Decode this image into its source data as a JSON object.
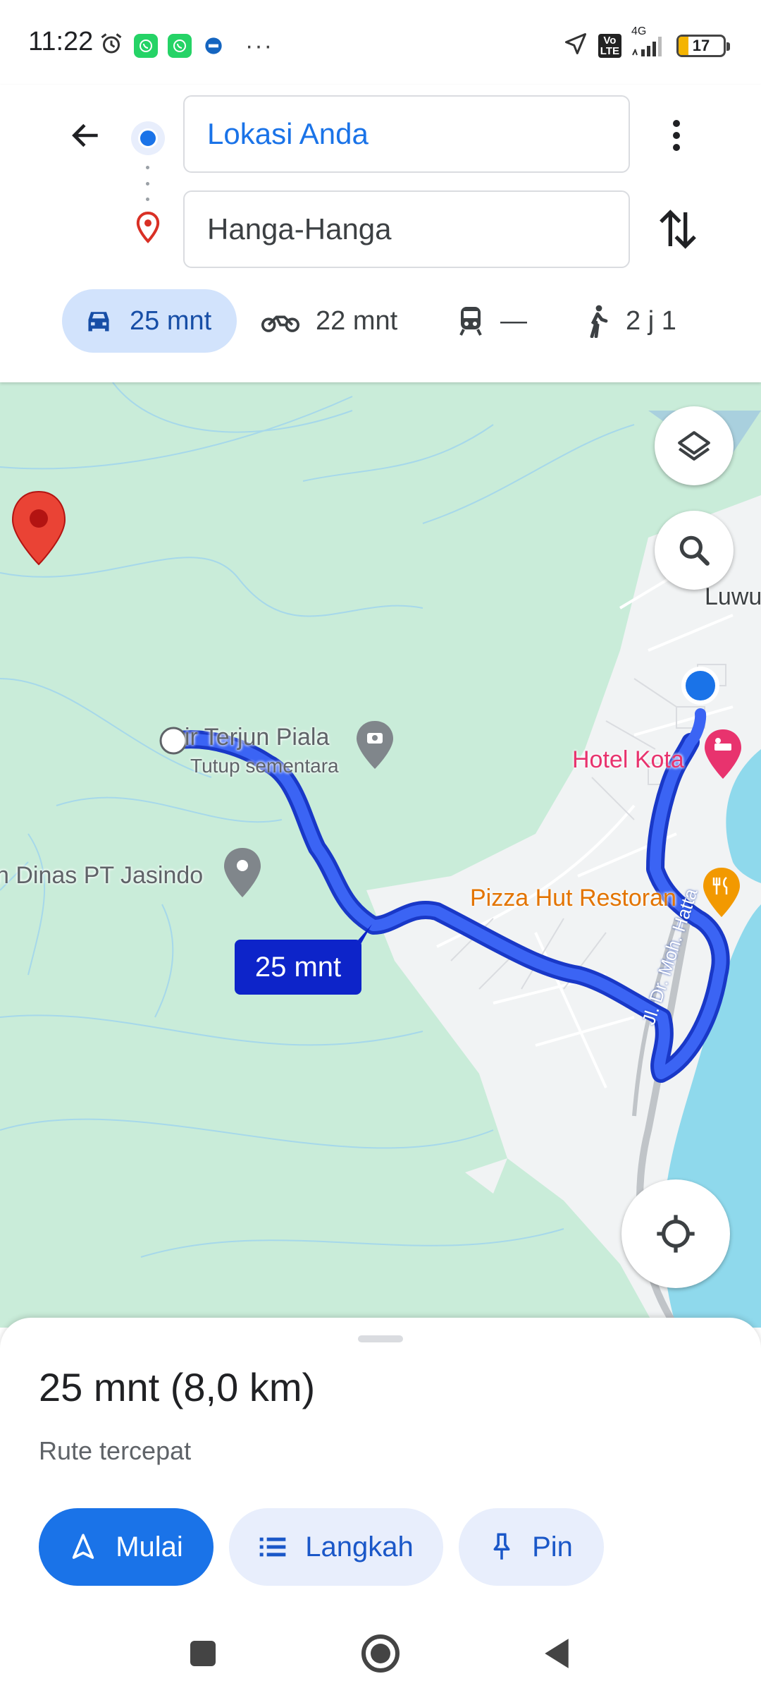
{
  "status_bar": {
    "time": "11:22",
    "network": "4G",
    "volte": "Vo LTE",
    "battery": "17"
  },
  "directions": {
    "origin": "Lokasi Anda",
    "destination": "Hanga-Hanga"
  },
  "travel_modes": [
    {
      "mode": "car",
      "time": "25 mnt",
      "selected": true
    },
    {
      "mode": "motorcycle",
      "time": "22 mnt",
      "selected": false
    },
    {
      "mode": "transit",
      "time": "—",
      "selected": false
    },
    {
      "mode": "walk",
      "time": "2 j 1",
      "selected": false
    }
  ],
  "map": {
    "labels": {
      "air_terjun": "ir Terjun Piala",
      "closed": "Tutup sementara",
      "dinas": "n Dinas PT Jasindo",
      "hotel": "Hotel Kota",
      "pizza": "Pizza Hut Restoran",
      "luwu": "Luwu",
      "road": "Jl. Dr. Moh. Hatta"
    },
    "route_eta": "25 mnt",
    "colors": {
      "route": "#1a3fd6",
      "park": "#c9ecd9",
      "water": "#8fd9ec",
      "urban": "#f1f3f4"
    }
  },
  "sheet": {
    "summary": "25 mnt (8,0 km)",
    "subtitle": "Rute tercepat",
    "start_label": "Mulai",
    "steps_label": "Langkah",
    "pin_label": "Pin"
  }
}
